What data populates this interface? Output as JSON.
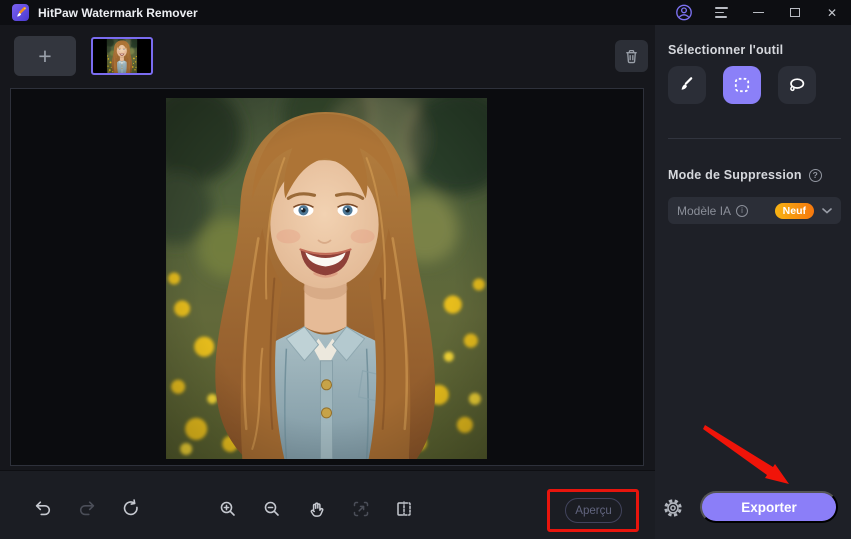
{
  "window": {
    "title": "HitPaw Watermark Remover"
  },
  "icons": {
    "add": "+",
    "close": "✕",
    "help": "?",
    "info": "i"
  },
  "sidebar": {
    "tool_section_title": "Sélectionner l'outil",
    "tools": [
      {
        "name": "brush",
        "active": false
      },
      {
        "name": "marquee-selection",
        "active": true
      },
      {
        "name": "lasso",
        "active": false
      }
    ],
    "mode_section_title": "Mode de Suppression",
    "model_label": "Modèle IA",
    "model_badge": "Neuf"
  },
  "bottombar": {
    "preview_label": "Aperçu",
    "export_label": "Exporter"
  },
  "colors": {
    "accent": "#8b80f8",
    "export_button": "#8b7ef8",
    "selected_thumbnail_border": "#7a6cf0",
    "badge_gradient_start": "#f7b313",
    "badge_gradient_end": "#f7780d",
    "annotation_red": "#e8150d"
  }
}
